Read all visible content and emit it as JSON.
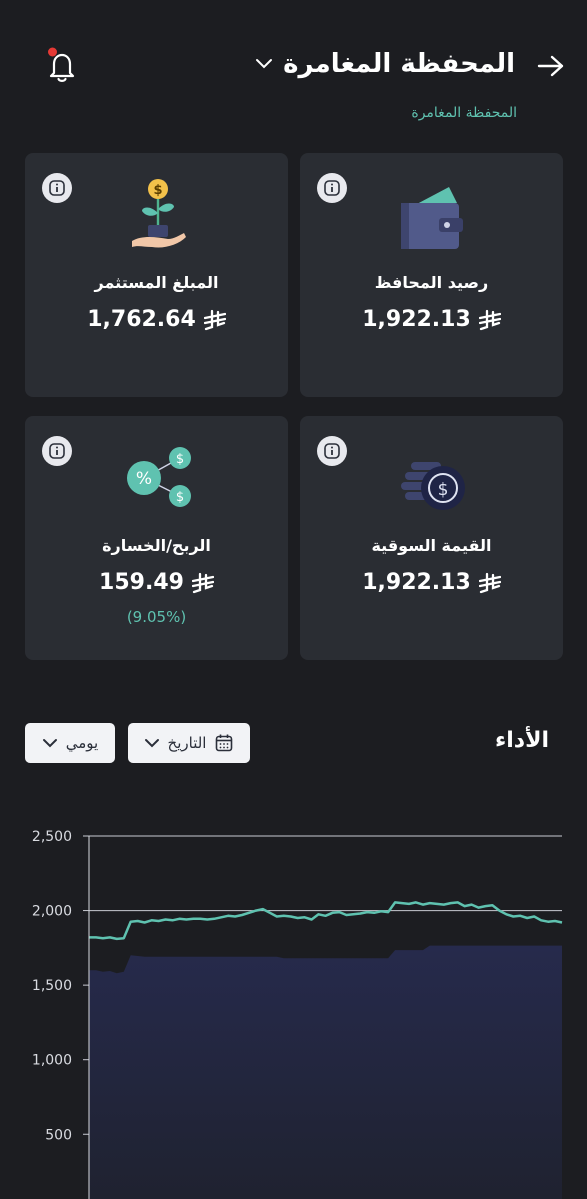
{
  "header": {
    "title": "المحفظة المغامرة",
    "breadcrumb": "المحفظة المغامرة"
  },
  "cards": [
    {
      "label": "رصيد المحافظ",
      "amount": "1,922.13"
    },
    {
      "label": "المبلغ المستثمر",
      "amount": "1,762.64"
    },
    {
      "label": "القيمة السوقية",
      "amount": "1,922.13"
    },
    {
      "label": "الربح/الخسارة",
      "amount": "159.49",
      "change": "(9.05%)"
    }
  ],
  "performance": {
    "title": "الأداء",
    "date_filter_label": "التاريخ",
    "period_label": "يومي"
  },
  "colors": {
    "background": "#1c1d21",
    "card": "#2a2d33",
    "accent": "#5fc2b0",
    "area": "#262a4c",
    "notification": "#e53935"
  },
  "icons": {
    "back": "arrow-right-icon",
    "dropdown": "chevron-down-icon",
    "notifications": "bell-icon",
    "info": "info-icon",
    "calendar": "calendar-icon",
    "currency": "saudi-riyal-icon"
  },
  "chart_data": {
    "type": "area",
    "ylim": [
      0,
      2500
    ],
    "yticks": [
      500,
      1000,
      1500,
      2000,
      2500
    ],
    "ytick_labels": [
      "500",
      "1,000",
      "1,500",
      "2,000",
      "2,500"
    ],
    "grid": true,
    "series": [
      {
        "values": [
          1820,
          1820,
          1815,
          1820,
          1810,
          1815,
          1925,
          1930,
          1920,
          1935,
          1930,
          1940,
          1935,
          1945,
          1940,
          1945,
          1945,
          1940,
          1945,
          1955,
          1965,
          1960,
          1970,
          1985,
          2000,
          2010,
          1985,
          1960,
          1965,
          1960,
          1950,
          1955,
          1940,
          1975,
          1965,
          1985,
          1990,
          1970,
          1975,
          1980,
          1990,
          1985,
          1995,
          1990,
          2055,
          2050,
          2045,
          2055,
          2040,
          2050,
          2045,
          2040,
          2050,
          2055,
          2030,
          2040,
          2020,
          2030,
          2035,
          2000,
          1975,
          1960,
          1965,
          1950,
          1960,
          1935,
          1925,
          1930,
          1920
        ]
      },
      {
        "values": [
          1600,
          1600,
          1590,
          1595,
          1580,
          1590,
          1700,
          1695,
          1690,
          1690,
          1690,
          1690,
          1690,
          1690,
          1690,
          1690,
          1690,
          1690,
          1690,
          1690,
          1690,
          1690,
          1690,
          1690,
          1690,
          1690,
          1690,
          1690,
          1680,
          1680,
          1680,
          1680,
          1680,
          1680,
          1680,
          1680,
          1680,
          1680,
          1680,
          1680,
          1680,
          1680,
          1680,
          1680,
          1735,
          1735,
          1735,
          1735,
          1735,
          1765,
          1765,
          1765,
          1765,
          1765,
          1765,
          1765,
          1765,
          1765,
          1765,
          1765,
          1765,
          1765,
          1765,
          1765,
          1765,
          1765,
          1765,
          1765,
          1765
        ]
      }
    ]
  }
}
